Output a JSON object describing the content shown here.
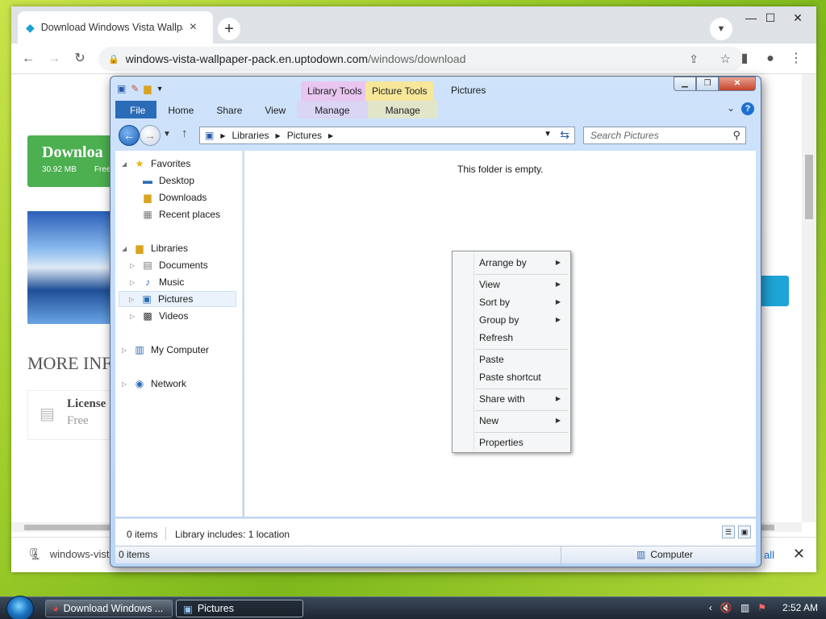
{
  "browser": {
    "tab_title": "Download Windows Vista Wallpa",
    "tab_close": "×",
    "new_tab": "+",
    "url_host": "windows-vista-wallpaper-pack.en.uptodown.com",
    "url_path": "/windows/download",
    "window_controls": {
      "minimize": "—",
      "maximize": "☐",
      "close": "✕"
    }
  },
  "webpage": {
    "download_label": "Downloa",
    "download_size": "30.92 MB",
    "download_free": "Free",
    "more_info": "MORE INFO",
    "license_label": "License",
    "license_value": "Free",
    "download_bar_file": "windows-vista",
    "download_bar_showall": "all"
  },
  "explorer": {
    "title": "Pictures",
    "context_tabs": [
      {
        "label": "Library Tools",
        "color": "#e8c6f0"
      },
      {
        "label": "Picture Tools",
        "color": "#f6e79a"
      }
    ],
    "ribbon_tabs": [
      "File",
      "Home",
      "Share",
      "View",
      "Manage",
      "Manage"
    ],
    "address": {
      "crumbs": [
        "Libraries",
        "Pictures"
      ]
    },
    "search_placeholder": "Search Pictures",
    "empty_message": "This folder is empty.",
    "nav": {
      "favorites": "Favorites",
      "desktop": "Desktop",
      "downloads": "Downloads",
      "recent": "Recent places",
      "libraries": "Libraries",
      "documents": "Documents",
      "music": "Music",
      "pictures": "Pictures",
      "videos": "Videos",
      "computer": "My Computer",
      "network": "Network"
    },
    "status": {
      "items": "0 items",
      "library_info": "Library includes: 1 location",
      "items_bottom": "0 items",
      "computer": "Computer"
    }
  },
  "context_menu": {
    "arrange_by": "Arrange by",
    "view": "View",
    "sort_by": "Sort by",
    "group_by": "Group by",
    "refresh": "Refresh",
    "paste": "Paste",
    "paste_shortcut": "Paste shortcut",
    "share_with": "Share with",
    "new": "New",
    "properties": "Properties"
  },
  "taskbar": {
    "items": [
      "Download Windows ...",
      "Pictures"
    ],
    "clock": "2:52 AM"
  }
}
